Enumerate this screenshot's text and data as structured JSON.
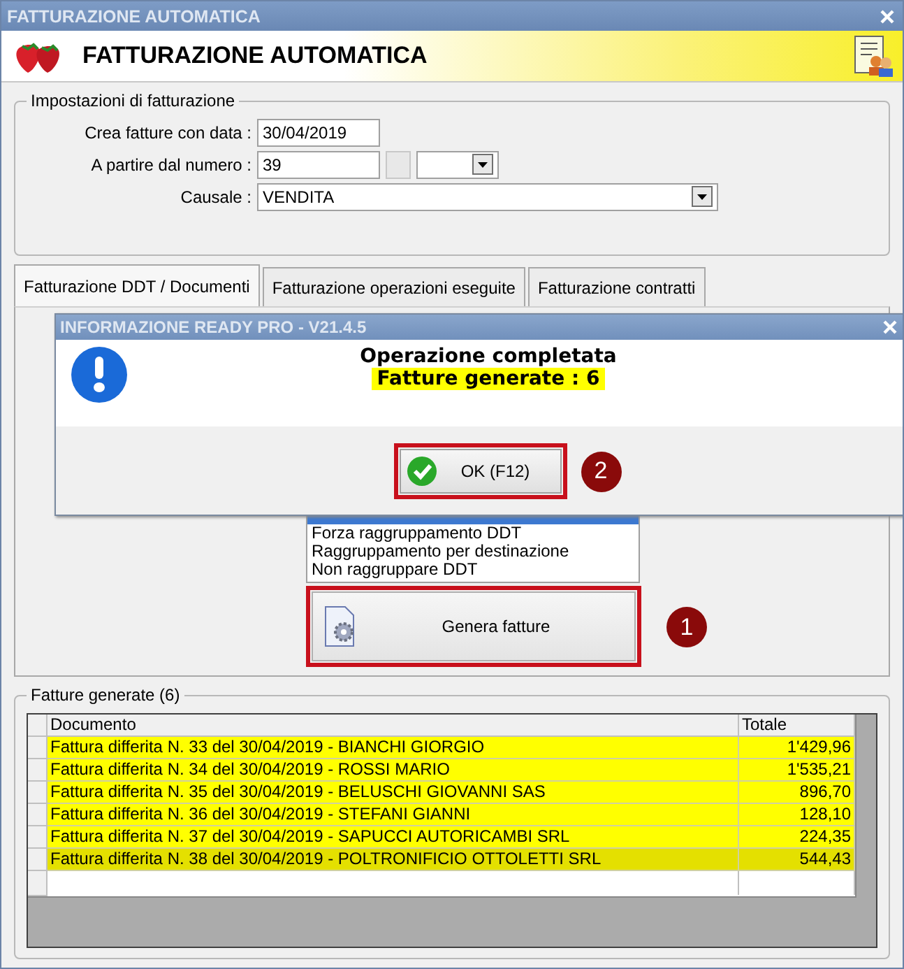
{
  "window": {
    "title": "FATTURAZIONE AUTOMATICA"
  },
  "header": {
    "title": "FATTURAZIONE AUTOMATICA"
  },
  "settings": {
    "legend": "Impostazioni di fatturazione",
    "fields": [
      {
        "label": "Crea fatture con data :",
        "value": "30/04/2019",
        "kind": "text"
      },
      {
        "label": "A partire dal numero :",
        "value": "39",
        "kind": "number_series"
      },
      {
        "label": "Causale :",
        "value": "VENDITA",
        "kind": "combo"
      }
    ]
  },
  "tabs": [
    {
      "label": "Fatturazione DDT / Documenti",
      "selected": true
    },
    {
      "label": "Fatturazione operazioni eseguite",
      "selected": false
    },
    {
      "label": "Fatturazione contratti",
      "selected": false
    }
  ],
  "grouping_list": {
    "items": [
      {
        "label": "Forza raggruppamento DDT",
        "selected": false
      },
      {
        "label": "Raggruppamento per destinazione",
        "selected": false
      },
      {
        "label": "Non raggruppare DDT",
        "selected": false
      }
    ]
  },
  "generate_button": {
    "label": "Genera fatture",
    "callout": "1"
  },
  "results": {
    "legend": "Fatture generate (6)",
    "columns": [
      "Documento",
      "Totale"
    ],
    "rows": [
      {
        "document": "Fattura differita N. 33 del 30/04/2019 - BIANCHI GIORGIO",
        "total": "1'429,96",
        "selected": false
      },
      {
        "document": "Fattura differita N. 34 del 30/04/2019 - ROSSI MARIO",
        "total": "1'535,21",
        "selected": false
      },
      {
        "document": "Fattura differita N. 35 del 30/04/2019 - BELUSCHI GIOVANNI SAS",
        "total": "896,70",
        "selected": false
      },
      {
        "document": "Fattura differita N. 36 del 30/04/2019 - STEFANI GIANNI",
        "total": "128,10",
        "selected": false
      },
      {
        "document": "Fattura differita N. 37 del 30/04/2019 - SAPUCCI AUTORICAMBI SRL",
        "total": "224,35",
        "selected": false
      },
      {
        "document": "Fattura differita N. 38 del 30/04/2019 - POLTRONIFICIO OTTOLETTI SRL",
        "total": "544,43",
        "selected": true
      }
    ]
  },
  "dialog": {
    "title": "INFORMAZIONE READY PRO - V21.4.5",
    "heading": "Operazione completata",
    "message": "Fatture generate : 6",
    "ok_button": {
      "label": "OK (F12)",
      "callout": "2"
    }
  }
}
